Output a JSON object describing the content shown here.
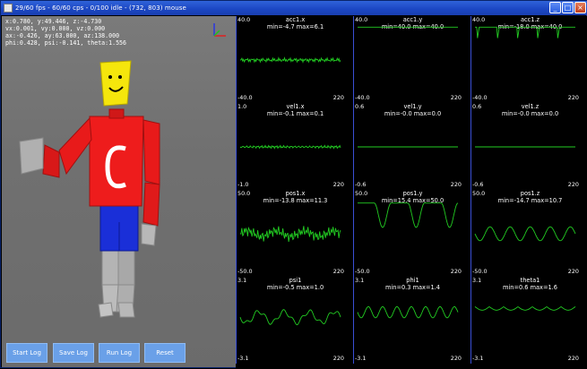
{
  "window": {
    "title": "29/60 fps - 60/60 cps - 0/100 idle - (732, 803) mouse",
    "minimize": "_",
    "maximize": "□",
    "close": "×"
  },
  "hud": {
    "line1": "x:0.780, y:49.446, z:-4.730",
    "line2": "vx:0.001, vy:0.000, vz:0.000",
    "line3": "ax:-0.426, ay:63.000, az:138.000",
    "line4": "phi:0.428, psi:-0.141, theta:1.556"
  },
  "buttons": {
    "start": "Start Log",
    "save": "Save Log",
    "run": "Run Log",
    "reset": "Reset"
  },
  "plots": [
    {
      "title": "acc1.x",
      "stats": "min=-4.7   max=6.1",
      "ymax": "40.0",
      "ymin": "-40.0",
      "xmax": "220",
      "shape": "noise",
      "base": 0.5,
      "amp": 0.03
    },
    {
      "title": "acc1.y",
      "stats": "min=40.0   max=40.0",
      "ymax": "40.0",
      "ymin": "-40.0",
      "xmax": "220",
      "shape": "flattop",
      "base": 0.03,
      "amp": 0.0
    },
    {
      "title": "acc1.z",
      "stats": "min=-18.0   max=40.0",
      "ymax": "40.0",
      "ymin": "-40.0",
      "xmax": "220",
      "shape": "spikes",
      "base": 0.03,
      "amp": 0.25
    },
    {
      "title": "vel1.x",
      "stats": "min=-0.1   max=0.1",
      "ymax": "1.0",
      "ymin": "-1.0",
      "xmax": "220",
      "shape": "smallnoise",
      "base": 0.5,
      "amp": 0.02
    },
    {
      "title": "vel1.y",
      "stats": "min=-0.0   max=0.0",
      "ymax": "0.6",
      "ymin": "-0.6",
      "xmax": "220",
      "shape": "flat",
      "base": 0.5,
      "amp": 0.0
    },
    {
      "title": "vel1.z",
      "stats": "min=-0.0   max=0.0",
      "ymax": "0.6",
      "ymin": "-0.6",
      "xmax": "220",
      "shape": "flat",
      "base": 0.5,
      "amp": 0.0
    },
    {
      "title": "pos1.x",
      "stats": "min=-13.8   max=11.3",
      "ymax": "50.0",
      "ymin": "-50.0",
      "xmax": "220",
      "shape": "bignoise",
      "base": 0.5,
      "amp": 0.1
    },
    {
      "title": "pos1.y",
      "stats": "min=15.4   max=50.0",
      "ymax": "50.0",
      "ymin": "-50.0",
      "xmax": "220",
      "shape": "dips",
      "base": 0.06,
      "amp": 0.35
    },
    {
      "title": "pos1.z",
      "stats": "min=-14.7   max=10.7",
      "ymax": "50.0",
      "ymin": "-50.0",
      "xmax": "220",
      "shape": "sine",
      "base": 0.5,
      "amp": 0.1
    },
    {
      "title": "psi1",
      "stats": "min=-0.5   max=1.0",
      "ymax": "3.1",
      "ymin": "-3.1",
      "xmax": "220",
      "shape": "wobble",
      "base": 0.45,
      "amp": 0.08
    },
    {
      "title": "phi1",
      "stats": "min=0.3   max=1.4",
      "ymax": "3.1",
      "ymin": "-3.1",
      "xmax": "220",
      "shape": "zigzag",
      "base": 0.38,
      "amp": 0.08
    },
    {
      "title": "theta1",
      "stats": "min=0.6   max=1.6",
      "ymax": "3.1",
      "ymin": "-3.1",
      "xmax": "220",
      "shape": "scallop",
      "base": 0.3,
      "amp": 0.05
    }
  ],
  "colors": {
    "trace": "#22cc22",
    "axis": "#3a4fd6",
    "body_red": "#ee1c1c",
    "legs_blue": "#1a2fd8",
    "head_yellow": "#f5e60c",
    "limbs_grey": "#b8b8b8"
  }
}
